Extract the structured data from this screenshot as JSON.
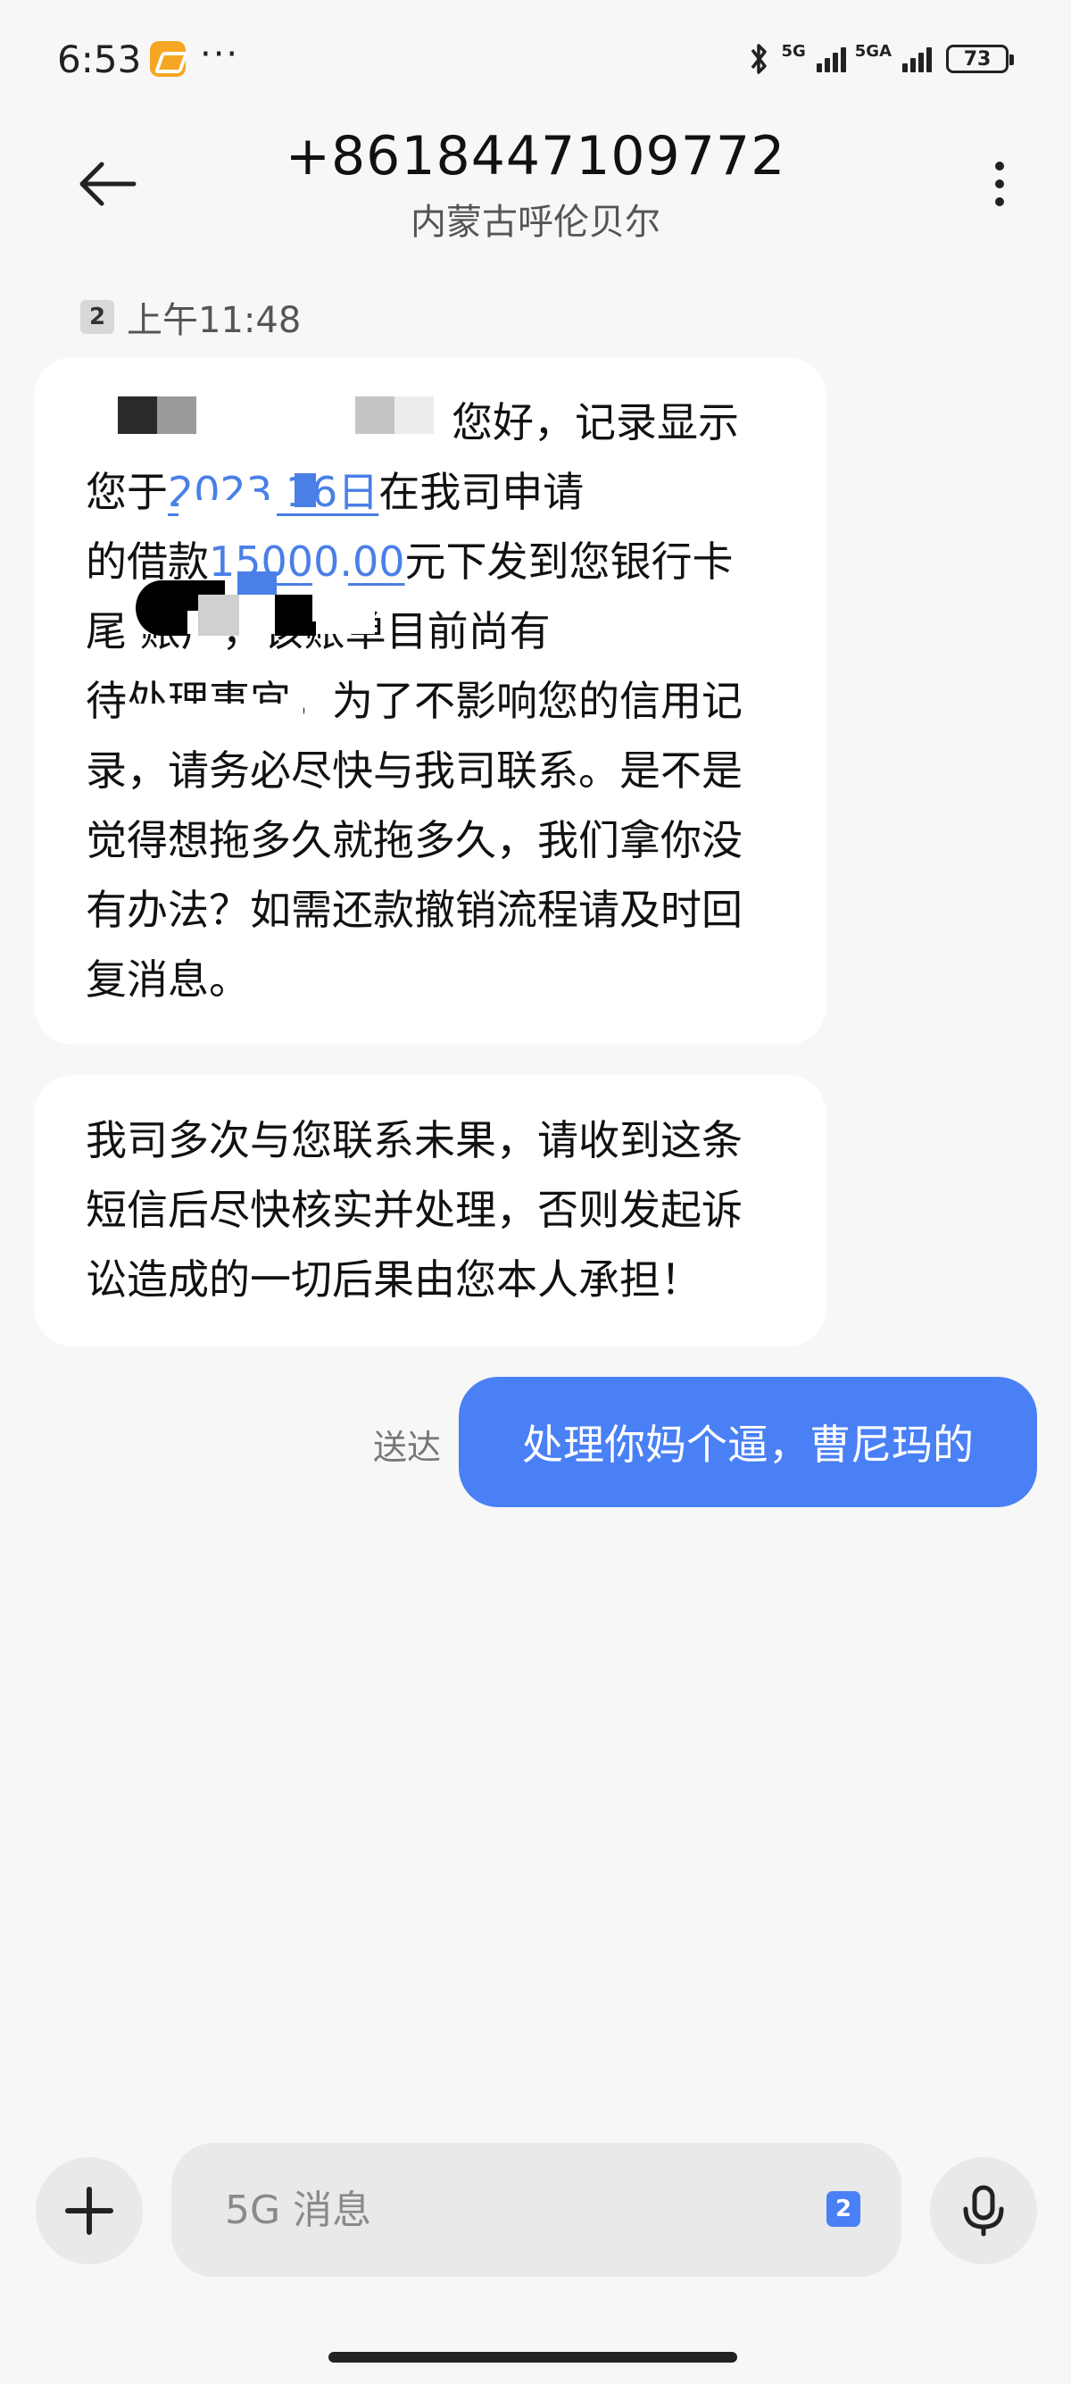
{
  "status_bar": {
    "time": "6:53",
    "dots": "···",
    "network_1": "5G",
    "network_2": "5GA",
    "battery": "73",
    "app_badge_color": "#f5a623"
  },
  "header": {
    "title": "+8618447109772",
    "subtitle": "内蒙古呼伦贝尔",
    "back_icon": "arrow-left-icon",
    "more_icon": "more-vertical-icon"
  },
  "meta": {
    "sim": "2",
    "time": "上午11:48"
  },
  "messages": {
    "incoming_1": {
      "lines": [
        {
          "pre": "",
          "link": "",
          "post": "您好，记录显示"
        },
        {
          "pre": "您于",
          "link": "2023      16日",
          "post": "在我司申请"
        },
        {
          "pre": "的借款",
          "link": "15000.00",
          "post": "元下发到您银行卡"
        },
        {
          "pre": "尾",
          "link": "",
          "post": "      账户，该账单目前尚有"
        },
        {
          "pre": "",
          "link": "",
          "post": "待处理事宜，为了不影响您的信用记"
        },
        {
          "pre": "",
          "link": "",
          "post": "录，请务必尽快与我司联系。是不是"
        },
        {
          "pre": "",
          "link": "",
          "post": "觉得想拖多久就拖多久，我们拿你没"
        },
        {
          "pre": "",
          "link": "",
          "post": "有办法？如需还款撤销流程请及时回"
        },
        {
          "pre": "",
          "link": "",
          "post": "复消息。"
        }
      ]
    },
    "incoming_2": {
      "lines": [
        "我司多次与您联系未果，请收到这条",
        "短信后尽快核实并处理，否则发起诉",
        "讼造成的一切后果由您本人承担！"
      ]
    },
    "outgoing": {
      "status": "送达",
      "text": "处理你妈个逼，曹尼玛的"
    }
  },
  "composer": {
    "placeholder": "5G 消息",
    "sim": "2",
    "plus_icon": "plus-icon",
    "mic_icon": "microphone-icon",
    "accent": "#4a80f5"
  }
}
